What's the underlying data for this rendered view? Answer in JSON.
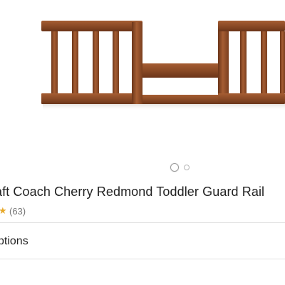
{
  "product": {
    "title": "aft Coach Cherry Redmond Toddler Guard Rail",
    "image_alt": "Coach Cherry Redmond Toddler Guard Rail",
    "wood_color": "#8a4a26",
    "wood_dark": "#6b3519",
    "wood_light": "#a55d33"
  },
  "carousel": {
    "total_dots": 2,
    "active_index": 0
  },
  "rating": {
    "star_icon": "★",
    "star_color": "#e7a92b",
    "review_count": "(63)"
  },
  "options": {
    "label": "ptions"
  }
}
